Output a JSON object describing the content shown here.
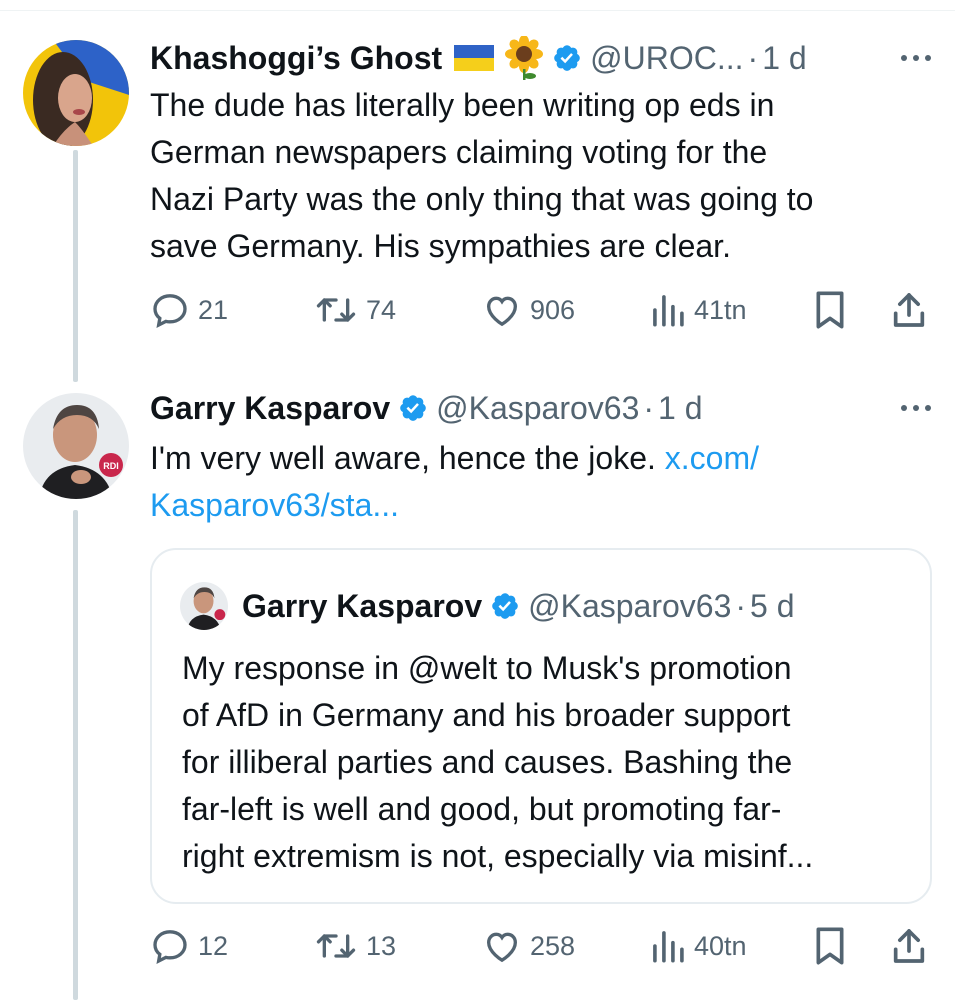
{
  "tweets": [
    {
      "author": {
        "name": "Khashoggi’s Ghost",
        "handle": "@UROC...",
        "verified": true,
        "badges": [
          "ukraine-flag",
          "sunflower"
        ]
      },
      "sep": "·",
      "time": "1 d",
      "text_lines": [
        "The dude has literally been writing op eds in",
        "German newspapers claiming voting for the",
        "Nazi Party was the only thing that was going to",
        "save Germany. His sympathies are clear."
      ],
      "stats": {
        "replies": "21",
        "reposts": "74",
        "likes": "906",
        "views": "41tn"
      }
    },
    {
      "author": {
        "name": "Garry Kasparov",
        "handle": "@Kasparov63",
        "verified": true
      },
      "sep": "·",
      "time": "1 d",
      "text_line1_plain": "I'm very well aware, hence the joke. ",
      "text_line1_link": "x.com/",
      "text_line2_link": "Kasparov63/sta...",
      "quote": {
        "author": {
          "name": "Garry Kasparov",
          "handle": "@Kasparov63",
          "verified": true
        },
        "sep": "·",
        "time": "5 d",
        "text_lines": [
          "My response in @welt to Musk's promotion",
          "of AfD in Germany and his broader support",
          "for illiberal parties and causes. Bashing the",
          "far-left is well and good, but promoting far-",
          "right extremism is not, especially via misinf..."
        ]
      },
      "stats": {
        "replies": "12",
        "reposts": "13",
        "likes": "258",
        "views": "40tn"
      }
    }
  ],
  "avatar_badge": "RDI",
  "colors": {
    "link": "#1d9bf0",
    "verified": "#1d9bf0",
    "secondary": "#536471",
    "thread_line": "#cfd9de"
  },
  "icons": [
    "reply-icon",
    "repost-icon",
    "like-icon",
    "views-icon",
    "bookmark-icon",
    "share-icon",
    "more-icon",
    "verified-icon"
  ]
}
